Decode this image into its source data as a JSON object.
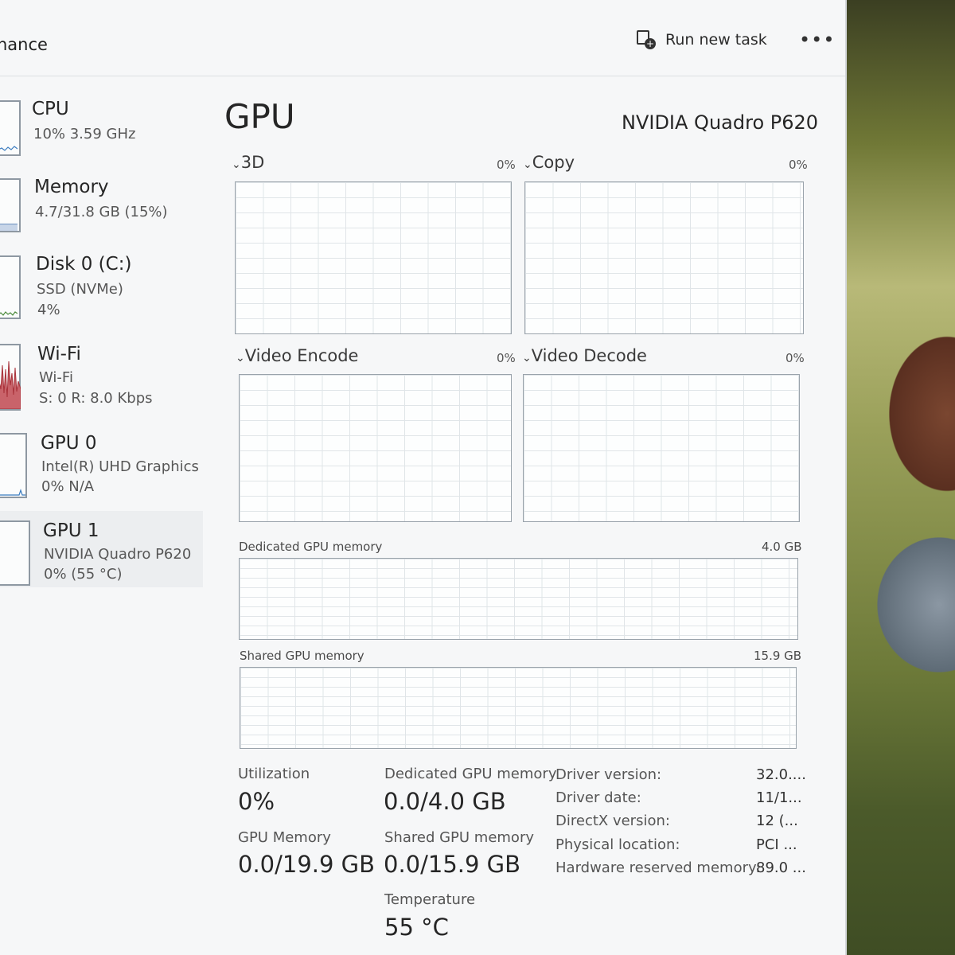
{
  "window": {
    "title": "nance",
    "run_new_task": "Run new task",
    "more_menu": "•••"
  },
  "sidebar": {
    "items": [
      {
        "name": "CPU",
        "sub1": "10%  3.59 GHz",
        "sub2": ""
      },
      {
        "name": "Memory",
        "sub1": "4.7/31.8 GB (15%)",
        "sub2": ""
      },
      {
        "name": "Disk 0 (C:)",
        "sub1": "SSD (NVMe)",
        "sub2": "4%"
      },
      {
        "name": "Wi-Fi",
        "sub1": "Wi-Fi",
        "sub2": "S: 0  R: 8.0 Kbps"
      },
      {
        "name": "GPU 0",
        "sub1": "Intel(R) UHD Graphics",
        "sub2": "0%  N/A"
      },
      {
        "name": "GPU 1",
        "sub1": "NVIDIA Quadro P620",
        "sub2": "0%  (55 °C)"
      }
    ]
  },
  "main": {
    "title": "GPU",
    "device": "NVIDIA Quadro P620",
    "engines": [
      {
        "label": "3D",
        "pct": "0%"
      },
      {
        "label": "Copy",
        "pct": "0%"
      },
      {
        "label": "Video Encode",
        "pct": "0%"
      },
      {
        "label": "Video Decode",
        "pct": "0%"
      }
    ],
    "dedicated_graph": {
      "label": "Dedicated GPU memory",
      "max": "4.0 GB"
    },
    "shared_graph": {
      "label": "Shared GPU memory",
      "max": "15.9 GB"
    },
    "stats": {
      "utilization_label": "Utilization",
      "utilization_value": "0%",
      "dedicated_label": "Dedicated GPU memory",
      "dedicated_value": "0.0/4.0 GB",
      "gpu_memory_label": "GPU Memory",
      "gpu_memory_value": "0.0/19.9 GB",
      "shared_label": "Shared GPU memory",
      "shared_value": "0.0/15.9 GB",
      "temperature_label": "Temperature",
      "temperature_value": "55 °C"
    },
    "info": [
      {
        "key": "Driver version:",
        "value": "32.0...."
      },
      {
        "key": "Driver date:",
        "value": "11/1..."
      },
      {
        "key": "DirectX version:",
        "value": "12 (..."
      },
      {
        "key": "Physical location:",
        "value": "PCI ..."
      },
      {
        "key": "Hardware reserved memory:",
        "value": "89.0 ..."
      }
    ]
  },
  "colors": {
    "window_bg": "#f6f7f8",
    "graph_border": "#9aa3ab",
    "wifi_activity": "#a8323a"
  }
}
